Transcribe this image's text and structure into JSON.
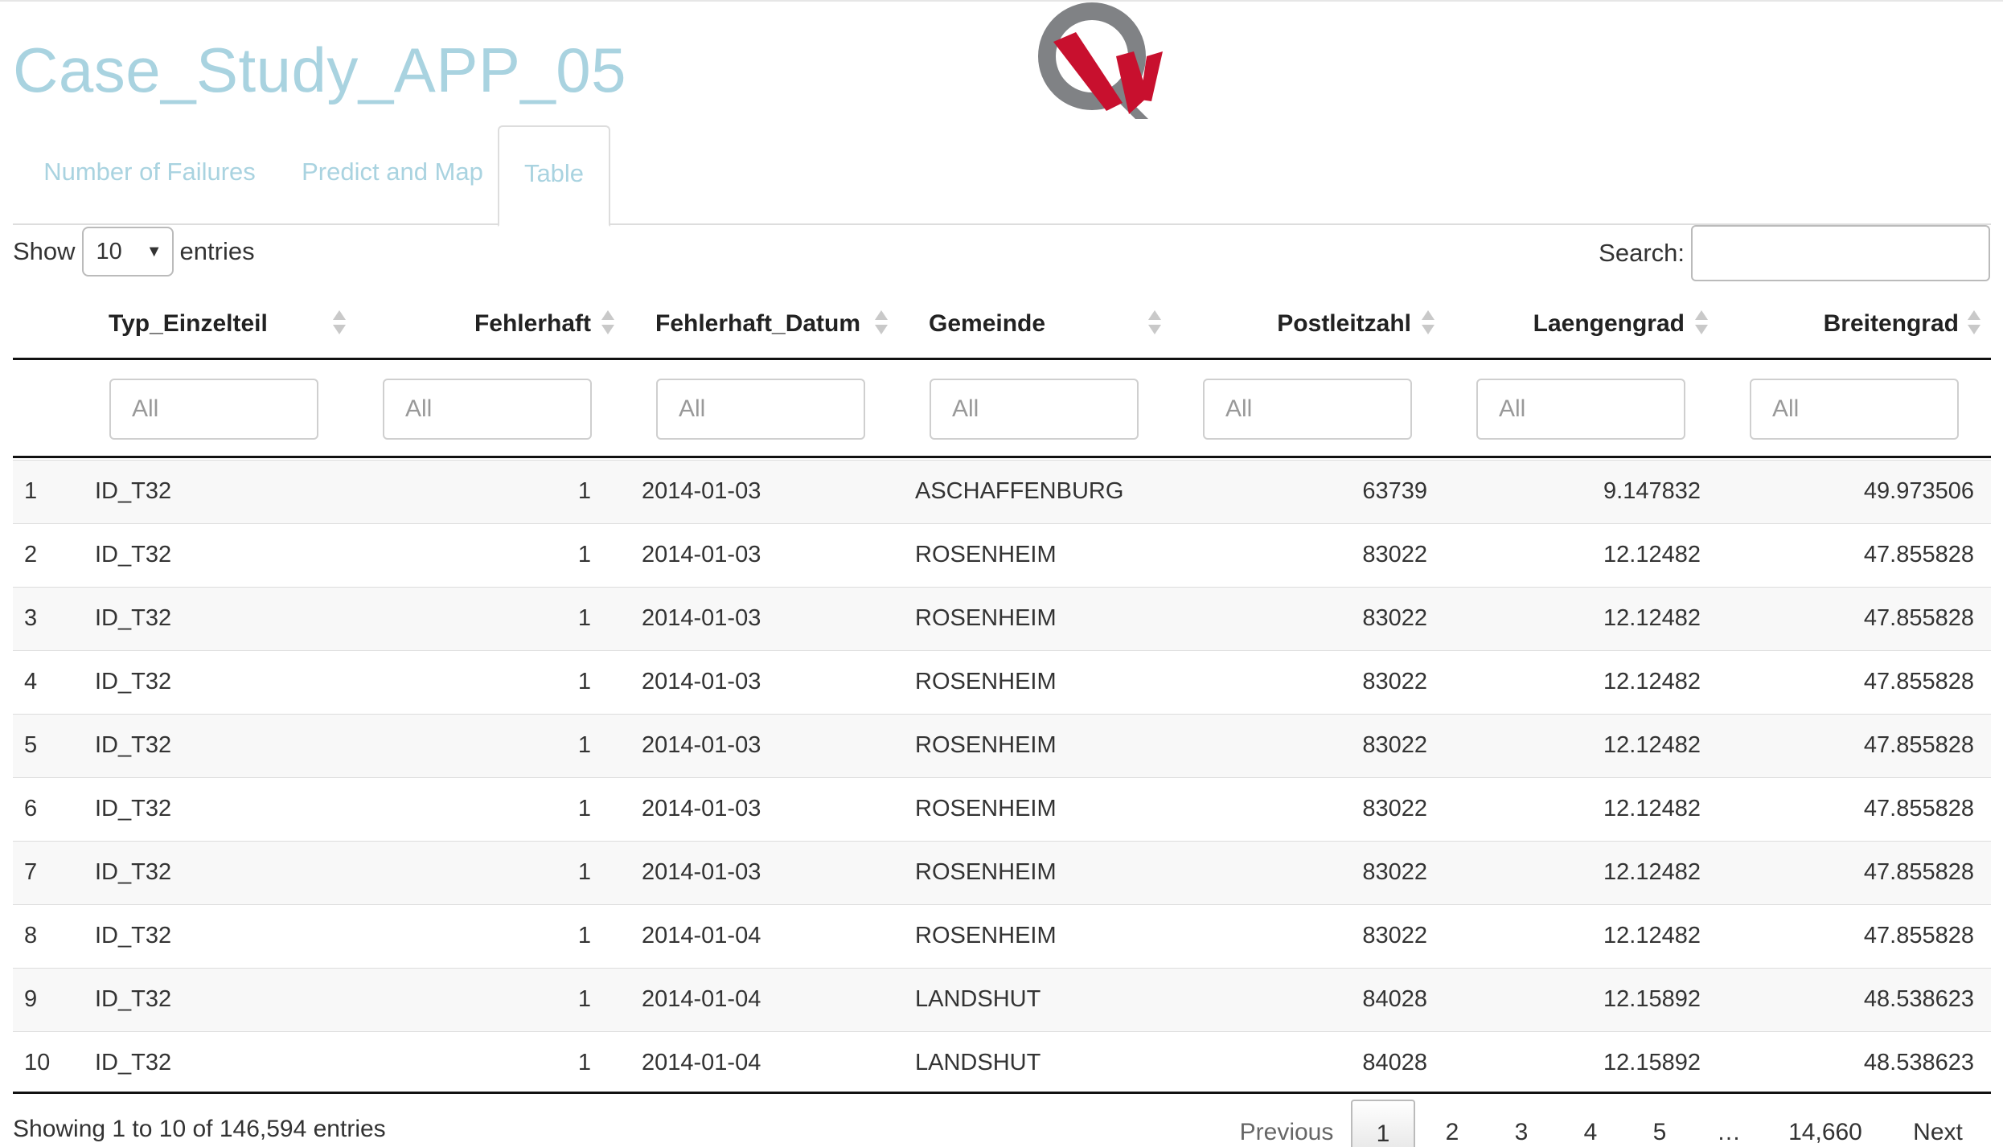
{
  "app": {
    "title": "Case_Study_APP_05"
  },
  "tabs": [
    {
      "label": "Number of Failures"
    },
    {
      "label": "Predict and Map"
    },
    {
      "label": "Table"
    }
  ],
  "controls": {
    "show_label": "Show",
    "entries_label": "entries",
    "page_length": "10",
    "search_label": "Search:",
    "search_value": ""
  },
  "table": {
    "columns": [
      "Typ_Einzelteil",
      "Fehlerhaft",
      "Fehlerhaft_Datum",
      "Gemeinde",
      "Postleitzahl",
      "Laengengrad",
      "Breitengrad"
    ],
    "filter_placeholder": "All",
    "rows": [
      [
        "1",
        "ID_T32",
        "1",
        "2014-01-03",
        "ASCHAFFENBURG",
        "63739",
        "9.147832",
        "49.973506"
      ],
      [
        "2",
        "ID_T32",
        "1",
        "2014-01-03",
        "ROSENHEIM",
        "83022",
        "12.12482",
        "47.855828"
      ],
      [
        "3",
        "ID_T32",
        "1",
        "2014-01-03",
        "ROSENHEIM",
        "83022",
        "12.12482",
        "47.855828"
      ],
      [
        "4",
        "ID_T32",
        "1",
        "2014-01-03",
        "ROSENHEIM",
        "83022",
        "12.12482",
        "47.855828"
      ],
      [
        "5",
        "ID_T32",
        "1",
        "2014-01-03",
        "ROSENHEIM",
        "83022",
        "12.12482",
        "47.855828"
      ],
      [
        "6",
        "ID_T32",
        "1",
        "2014-01-03",
        "ROSENHEIM",
        "83022",
        "12.12482",
        "47.855828"
      ],
      [
        "7",
        "ID_T32",
        "1",
        "2014-01-03",
        "ROSENHEIM",
        "83022",
        "12.12482",
        "47.855828"
      ],
      [
        "8",
        "ID_T32",
        "1",
        "2014-01-04",
        "ROSENHEIM",
        "83022",
        "12.12482",
        "47.855828"
      ],
      [
        "9",
        "ID_T32",
        "1",
        "2014-01-04",
        "LANDSHUT",
        "84028",
        "12.15892",
        "48.538623"
      ],
      [
        "10",
        "ID_T32",
        "1",
        "2014-01-04",
        "LANDSHUT",
        "84028",
        "12.15892",
        "48.538623"
      ]
    ]
  },
  "footer": {
    "info": "Showing 1 to 10 of 146,594 entries",
    "pagination": {
      "previous": "Previous",
      "pages": [
        "1",
        "2",
        "3",
        "4",
        "5",
        "…",
        "14,660"
      ],
      "next": "Next",
      "current": "1"
    }
  },
  "colors": {
    "title": "#a9d3e0",
    "logo_red": "#c8102e",
    "logo_gray": "#808285"
  },
  "icons": {
    "logo": "qw-logo",
    "sort": "sort-both-icon",
    "dropdown": "caret-down-icon"
  }
}
